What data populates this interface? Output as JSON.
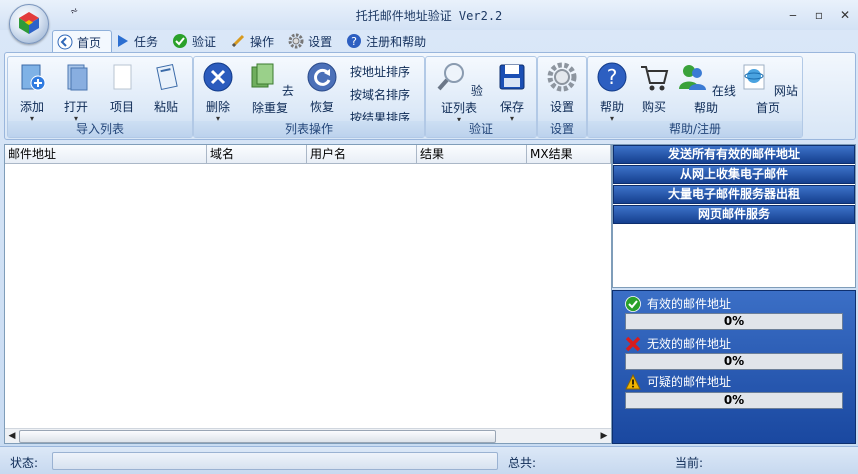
{
  "window": {
    "title": "托托邮件地址验证 Ver2.2",
    "qat_glyph": "⩫",
    "minimize": "‒",
    "maximize": "▫",
    "close": "✕"
  },
  "tabs": [
    {
      "label": "首页",
      "icon": "home-icon"
    },
    {
      "label": "任务",
      "icon": "play-icon"
    },
    {
      "label": "验证",
      "icon": "check-icon"
    },
    {
      "label": "操作",
      "icon": "pen-icon"
    },
    {
      "label": "设置",
      "icon": "gear-icon"
    },
    {
      "label": "注册和帮助",
      "icon": "help-icon"
    }
  ],
  "ribbon": {
    "import": {
      "label": "导入列表",
      "add": "添加",
      "open": "打开",
      "item": "项目",
      "paste": "粘贴"
    },
    "list_ops": {
      "label": "列表操作",
      "delete": "删除",
      "dedupe": "去除重复",
      "restore": "恢复",
      "sort_address": "按地址排序",
      "sort_domain": "按域名排序",
      "sort_result": "按结果排序"
    },
    "verify": {
      "label": "验证",
      "verify_list": "验证列表",
      "save": "保存"
    },
    "settings": {
      "label": "设置",
      "settings": "设置"
    },
    "help": {
      "label": "帮助/注册",
      "help": "帮助",
      "buy": "购买",
      "online_help": "在线帮助",
      "homepage": "网站首页"
    }
  },
  "table": {
    "columns": [
      "邮件地址",
      "域名",
      "用户名",
      "结果",
      "MX结果"
    ]
  },
  "links": [
    "发送所有有效的邮件地址",
    "从网上收集电子邮件",
    "大量电子邮件服务器出租",
    "网页邮件服务"
  ],
  "stats": {
    "valid": {
      "label": "有效的邮件地址",
      "value": "0%"
    },
    "invalid": {
      "label": "无效的邮件地址",
      "value": "0%"
    },
    "suspicious": {
      "label": "可疑的邮件地址",
      "value": "0%"
    }
  },
  "status": {
    "state_label": "状态:",
    "total_label": "总共:",
    "current_label": "当前:"
  },
  "colors": {
    "link_bg": "#1f4fa3",
    "stats_bg": "#2a5cb6",
    "valid": "#2aa12a",
    "invalid": "#d81c1c",
    "warning": "#f0b400"
  }
}
